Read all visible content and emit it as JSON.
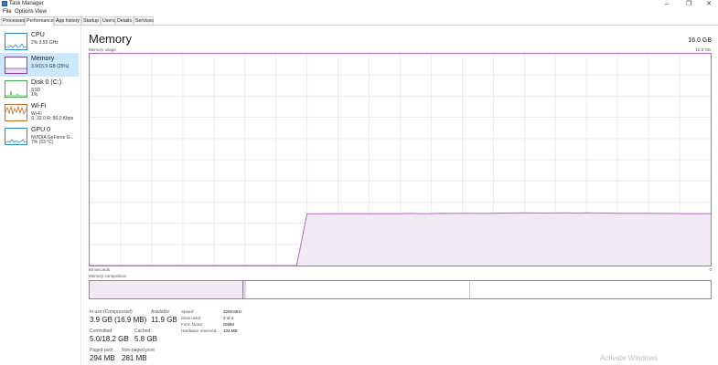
{
  "app": {
    "title": "Task Manager"
  },
  "window_controls": {
    "minimize": "–",
    "maximize": "❐",
    "close": "✕"
  },
  "menu": [
    "File",
    "Options",
    "View"
  ],
  "tabs": [
    "Processes",
    "Performance",
    "App history",
    "Startup",
    "Users",
    "Details",
    "Services"
  ],
  "active_tab": "Performance",
  "sidebar": [
    {
      "title": "CPU",
      "lines": [
        "2% 3.55 GHz"
      ],
      "icon": "cpu-graph",
      "color": "#2b8dd8"
    },
    {
      "title": "Memory",
      "lines": [
        "3.9/15.9 GB (25%)"
      ],
      "icon": "memory-graph",
      "color": "#8b3ea8",
      "selected": true
    },
    {
      "title": "Disk 0 (C:)",
      "lines": [
        "SSD",
        "1%"
      ],
      "icon": "disk-graph",
      "color": "#4ca84c"
    },
    {
      "title": "Wi-Fi",
      "lines": [
        "Wi-Fi",
        "S: 32.0  R: 56.0 Kbps"
      ],
      "icon": "wifi-graph",
      "color": "#c86a2a"
    },
    {
      "title": "GPU 0",
      "lines": [
        "NVIDIA GeForce G...",
        "7% (33 °C)"
      ],
      "icon": "gpu-graph",
      "color": "#2b8dd8"
    }
  ],
  "memory": {
    "title": "Memory",
    "total": "16.0 GB",
    "usage_label": "Memory usage",
    "usage_max": "15.9 GB",
    "time_left": "60 seconds",
    "time_right": "0",
    "composition_label": "Memory composition",
    "accent": "#b667c7"
  },
  "stats": {
    "in_use_label": "In use (Compressed)",
    "in_use_value": "3.9 GB (16.9 MB)",
    "available_label": "Available",
    "available_value": "11.9 GB",
    "committed_label": "Committed",
    "committed_value": "5.0/18.2 GB",
    "cached_label": "Cached",
    "cached_value": "5.8 GB",
    "paged_label": "Paged pool",
    "paged_value": "294 MB",
    "nonpaged_label": "Non-paged pool",
    "nonpaged_value": "281 MB"
  },
  "specs": [
    {
      "label": "Speed:",
      "value": "3200 MHz"
    },
    {
      "label": "Slots used:",
      "value": "2 of 4"
    },
    {
      "label": "Form factor:",
      "value": "DIMM"
    },
    {
      "label": "Hardware reserved:",
      "value": "134 MB"
    }
  ],
  "watermark": "Activate Windows",
  "chart_data": {
    "type": "area",
    "title": "Memory usage",
    "xlabel": "",
    "ylabel": "",
    "x_range_seconds": [
      60,
      0
    ],
    "ylim": [
      0,
      15.9
    ],
    "grid": true,
    "series": [
      {
        "values": [
          0,
          0,
          0,
          0,
          0,
          0,
          0,
          0,
          0,
          0,
          0,
          0,
          0,
          0,
          0,
          0,
          0,
          0,
          0,
          0,
          0,
          3.89,
          3.89,
          3.89,
          3.9,
          3.9,
          3.9,
          3.89,
          3.9,
          3.9,
          3.9,
          3.91,
          3.9,
          3.9,
          3.92,
          3.91,
          3.93,
          3.92,
          3.91,
          3.92,
          3.94,
          3.95,
          3.96,
          3.95,
          3.94,
          3.95,
          3.96,
          3.94,
          3.96,
          3.95,
          3.94,
          3.93,
          3.93,
          3.92,
          3.92,
          3.91,
          3.91,
          3.9,
          3.9,
          3.9,
          3.9
        ]
      }
    ]
  }
}
